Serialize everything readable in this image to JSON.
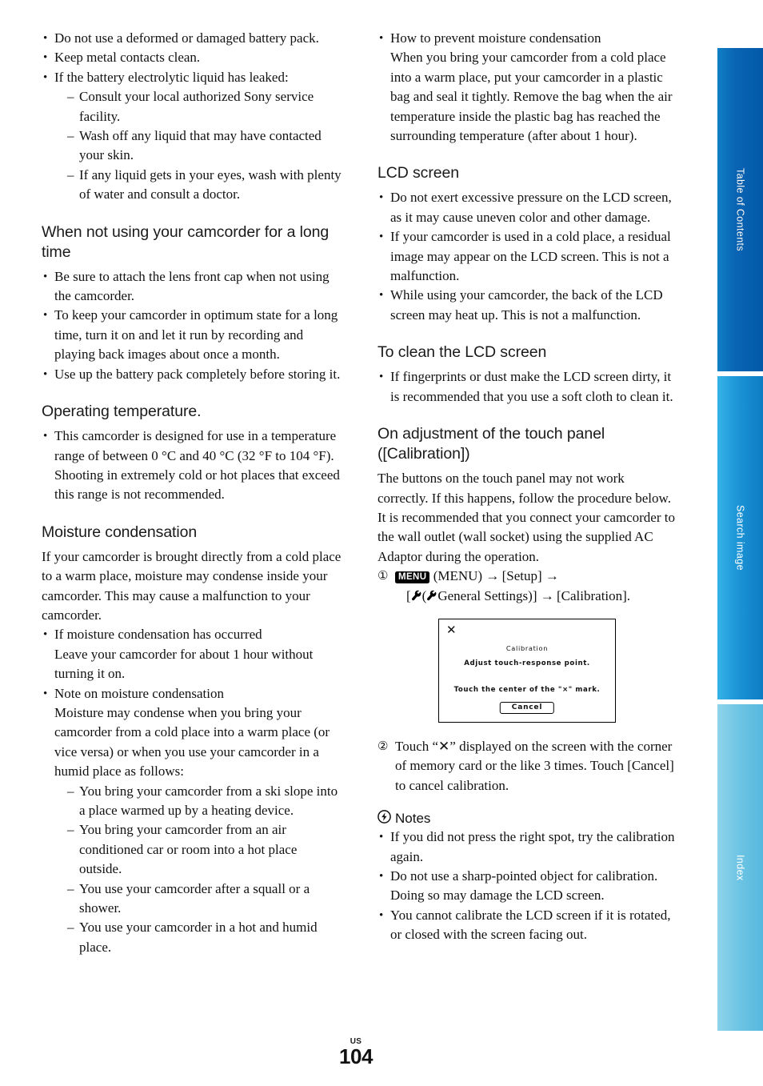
{
  "page": {
    "region_label": "US",
    "number": "104"
  },
  "left_column": {
    "battery_list": [
      {
        "text": "Do not use a deformed or damaged battery pack."
      },
      {
        "text": "Keep metal contacts clean."
      },
      {
        "text": "If the battery electrolytic liquid has leaked:",
        "sub": [
          "Consult your local authorized Sony service facility.",
          "Wash off any liquid that may have contacted your skin.",
          "If any liquid gets in your eyes, wash with plenty of water and consult a doctor."
        ]
      }
    ],
    "section_not_using": {
      "heading": "When not using your camcorder for a long time",
      "items": [
        "Be sure to attach the lens front cap when not using the camcorder.",
        "To keep your camcorder in optimum state for a long time, turn it on and let it run by recording and playing back images about once a month.",
        "Use up the battery pack completely before storing it."
      ]
    },
    "section_operating_temp": {
      "heading": "Operating temperature.",
      "items": [
        "This camcorder is designed for use in a temperature range of between 0 °C and 40 °C (32 °F to 104 °F). Shooting in extremely cold or hot places that exceed this range is not recommended."
      ]
    },
    "section_moisture": {
      "heading": "Moisture condensation",
      "intro": "If your camcorder is brought directly from a cold place to a warm place, moisture may condense inside your camcorder. This may cause a malfunction to your camcorder.",
      "items": [
        {
          "text": "If moisture condensation has occurred",
          "continuation": "Leave your camcorder for about 1 hour without turning it on."
        },
        {
          "text": "Note on moisture condensation",
          "continuation": "Moisture may condense when you bring your camcorder from a cold place into a warm place (or vice versa) or when you use your camcorder in a humid place as follows:",
          "sub": [
            "You bring your camcorder from a ski slope into a place warmed up by a heating device.",
            "You bring your camcorder from an air conditioned car or room into a hot place outside.",
            "You use your camcorder after a squall or a shower.",
            "You use your camcorder in a hot and humid place."
          ]
        }
      ]
    }
  },
  "right_column": {
    "moisture_prevent": {
      "text": "How to prevent moisture condensation",
      "continuation": "When you bring your camcorder from a cold place into a warm place, put your camcorder in a plastic bag and seal it tightly. Remove the bag when the air temperature inside the plastic bag has reached the surrounding temperature (after about 1 hour)."
    },
    "section_lcd_screen": {
      "heading": "LCD screen",
      "items": [
        "Do not exert excessive pressure on the LCD screen, as it may cause uneven color and other damage.",
        "If your camcorder is used in a cold place, a residual image may appear on the LCD screen. This is not a malfunction.",
        "While using your camcorder, the back of the LCD screen may heat up. This is not a malfunction."
      ]
    },
    "section_clean_lcd": {
      "heading": "To clean the LCD screen",
      "items": [
        "If fingerprints or dust make the LCD screen dirty, it is recommended that you use a soft cloth to clean it."
      ]
    },
    "section_touch_panel": {
      "heading": "On adjustment of the touch panel ([Calibration])",
      "intro": "The buttons on the touch panel may not work correctly. If this happens, follow the procedure below. It is recommended that you connect your camcorder to the wall outlet (wall socket) using the supplied AC Adaptor during the operation.",
      "step1": {
        "marker": "①",
        "menu_badge": "MENU",
        "part1": "(MENU)",
        "arrow": "→",
        "setup": "[Setup]",
        "arrow2": "→",
        "bracket_open": "[",
        "paren_open": "(",
        "general_settings": "General Settings)]",
        "arrow3": "→",
        "calibration": "[Calibration]."
      },
      "step2": {
        "marker": "②",
        "text": "Touch “✕” displayed on the screen with the corner of memory card or the like 3 times. Touch [Cancel] to cancel calibration."
      }
    },
    "calibration_figure": {
      "close_mark": "✕",
      "title": "Calibration",
      "line1": "Adjust touch-response point.",
      "line2": "Touch the center of the \"×\" mark.",
      "cancel_button": "Cancel"
    },
    "notes": {
      "icon": "bolt-circle-icon",
      "heading": "Notes",
      "items": [
        "If you did not press the right spot, try the calibration again.",
        "Do not use a sharp-pointed object for calibration. Doing so may damage the LCD screen.",
        "You cannot calibrate the LCD screen if it is rotated, or closed with the screen facing out."
      ]
    }
  },
  "side_tabs": [
    {
      "id": "table-of-contents",
      "label": "Table of Contents",
      "color": "#0a64b4"
    },
    {
      "id": "search-image",
      "label": "Search image",
      "color": "#1c94d6"
    },
    {
      "id": "index",
      "label": "Index",
      "color": "#6fc5e4"
    }
  ]
}
